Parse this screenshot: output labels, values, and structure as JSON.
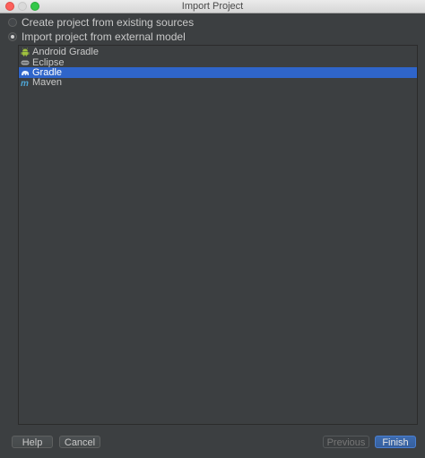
{
  "window": {
    "title": "Import Project"
  },
  "options": [
    {
      "label": "Create project from existing sources",
      "checked": false
    },
    {
      "label": "Import project from external model",
      "checked": true
    }
  ],
  "models": [
    {
      "label": "Android Gradle",
      "icon": "android-icon",
      "selected": false
    },
    {
      "label": "Eclipse",
      "icon": "eclipse-icon",
      "selected": false
    },
    {
      "label": "Gradle",
      "icon": "gradle-icon",
      "selected": true
    },
    {
      "label": "Maven",
      "icon": "maven-icon",
      "selected": false
    }
  ],
  "buttons": {
    "help": "Help",
    "cancel": "Cancel",
    "previous": "Previous",
    "finish": "Finish"
  },
  "colors": {
    "background": "#3c3f41",
    "selection": "#2f65ca",
    "primary_button": "#365f9e"
  }
}
